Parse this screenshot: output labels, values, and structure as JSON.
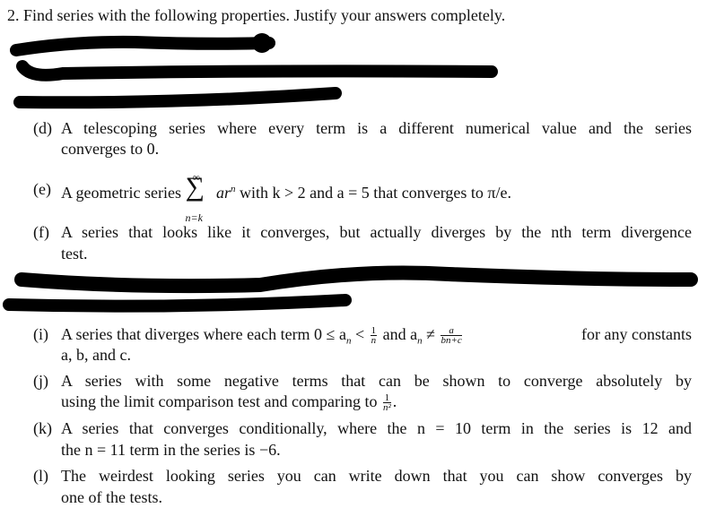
{
  "title": "2. Find series with the following properties. Justify your answers completely.",
  "items": [
    {
      "label": "(d)",
      "line1": "A telescoping series where every term is a different numerical value and the series",
      "line2": "converges to 0."
    },
    {
      "label": "(e)",
      "pre": "A geometric series",
      "sum_top": "∞",
      "sum_sym": "∑",
      "sum_bottom": "n=k",
      "term": "ar",
      "term_exp": "n",
      "post": "with k > 2 and a = 5 that converges to π/e."
    },
    {
      "label": "(f)",
      "line1": "A series that looks like it converges, but actually diverges by the nth term divergence",
      "line2": "test."
    },
    {
      "label": "(i)",
      "pre": "A series that diverges where each term 0 ≤ a",
      "sub": "n",
      "mid": "<",
      "frac1_num": "1",
      "frac1_den": "n",
      "mid2": "and a",
      "sub2": "n",
      "neq": "≠",
      "frac2_num": "a",
      "frac2_den": "bn+c",
      "post": "for any constants",
      "line2": "a, b, and c."
    },
    {
      "label": "(j)",
      "line1": "A series with some negative terms that can be shown to converge absolutely by",
      "line2_pre": "using the limit comparison test and comparing to",
      "frac_num": "1",
      "frac_den": "n²",
      "line2_post": "."
    },
    {
      "label": "(k)",
      "line1": "A series that converges conditionally, where the n = 10 term in the series is 12 and",
      "line2": "the n = 11 term in the series is −6."
    },
    {
      "label": "(l)",
      "line1": "The weirdest looking series you can write down that you can show converges by",
      "line2": "one of the tests."
    }
  ],
  "redaction_color": "#000000"
}
